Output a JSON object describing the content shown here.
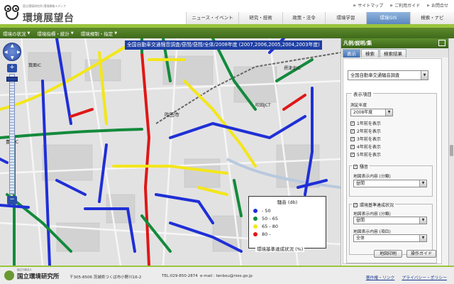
{
  "header": {
    "logo_subtitle_1": "国立環境研究所 環境情報メディア",
    "logo_title": "環境展望台",
    "util_links": [
      "サイトマップ",
      "ご利用ガイド",
      "お問合せ"
    ],
    "nav_tabs": [
      {
        "label": "ニュース・イベント",
        "active": false
      },
      {
        "label": "研究・技術",
        "active": false
      },
      {
        "label": "政策・法令",
        "active": false
      },
      {
        "label": "環境学習",
        "active": false
      },
      {
        "label": "環境GIS",
        "active": true
      },
      {
        "label": "検索・ナビ",
        "active": false
      }
    ]
  },
  "menubar": {
    "items": [
      "環境の状況",
      "環境指標・統計",
      "環境規制・指定"
    ]
  },
  "map": {
    "title": "全国自動車交通騒音調査/昼間/昼間/全体/2008年度 (2007,2006,2005,2004,2003年度)",
    "labels": {
      "city_hall": "吹田市",
      "minoh_ic": "箕面IC",
      "toyonaka_ic": "豊中IC",
      "suita_jct": "吹田JCT",
      "settsu": "摂津北IC"
    },
    "legend": {
      "title": "騒音 (db)",
      "items": [
        {
          "label": "- 50",
          "color": "#1f2fd6"
        },
        {
          "label": "50 - 65",
          "color": "#138a3c"
        },
        {
          "label": "65 - 80",
          "color": "#f3e61a"
        },
        {
          "label": "80 -",
          "color": "#e01616"
        }
      ],
      "footer": "環境基準達成状況 (%)"
    }
  },
  "panel": {
    "header": "凡例/説明/集",
    "tabs": [
      {
        "label": "表示",
        "active": true
      },
      {
        "label": "検索",
        "active": false
      },
      {
        "label": "検索結果",
        "active": false
      }
    ],
    "survey_select": "全国自動車交通騒音調査",
    "display_items_title": "表示項目",
    "year_label": "測定年度",
    "year_select": "2008年度",
    "year_checks": [
      "1年前を表示",
      "2年前を表示",
      "3年前を表示",
      "4年前を表示",
      "5年前を表示"
    ],
    "noise_label": "騒音",
    "noise_content_label": "地図表示内容 (分類)",
    "noise_content_select": "昼間",
    "standard_label": "環境基準達成状況",
    "standard_class_label": "地図表示内容 (分類)",
    "standard_class_select": "昼間",
    "standard_item_label": "地図表示内容 (項目)",
    "standard_item_select": "全体",
    "print_button": "地図印刷",
    "guide_button": "操作ガイド"
  },
  "footer": {
    "small": "独立行政法人",
    "org": "国立環境研究所",
    "address": "〒305-8506 茨城県つくば市小野川16-2",
    "tel": "TEL:029-850-2874",
    "mail": "e-mail : tenbou@nies.go.jp",
    "links": [
      "著作権・リンク",
      "プライバシー・ポリシー"
    ]
  }
}
